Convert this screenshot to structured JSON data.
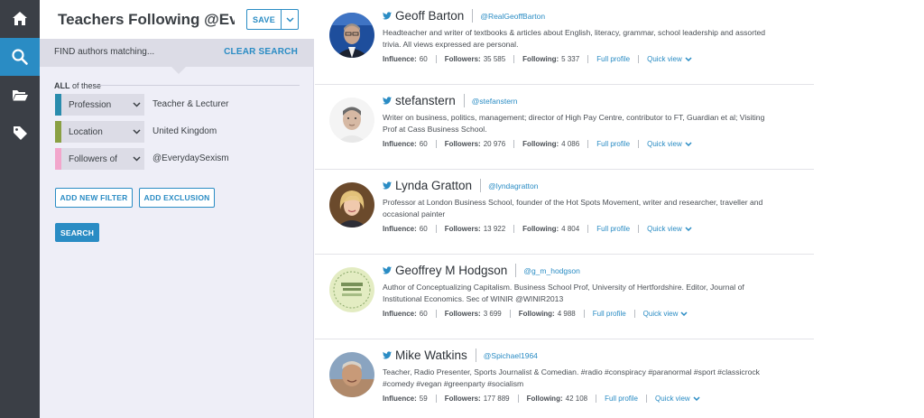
{
  "rail": {
    "items": [
      {
        "icon": "home-icon",
        "active": false
      },
      {
        "icon": "search-icon",
        "active": true
      },
      {
        "icon": "folder-open-icon",
        "active": false
      },
      {
        "icon": "tag-icon",
        "active": false
      }
    ]
  },
  "panel": {
    "title": "Teachers Following @Eve...",
    "save_label": "SAVE",
    "find_label": "FIND authors matching...",
    "clear_search": "CLEAR SEARCH",
    "all_strong": "ALL",
    "all_rest": " of these",
    "filters": [
      {
        "name": "Profession",
        "value": "Teacher & Lecturer",
        "color": "#2a8cad"
      },
      {
        "name": "Location",
        "value": "United Kingdom",
        "color": "#8aa044"
      },
      {
        "name": "Followers of",
        "value": "@EverydaySexism",
        "color": "#f2a6cc"
      }
    ],
    "add_filter": "ADD NEW FILTER",
    "add_exclusion": "ADD EXCLUSION",
    "search": "SEARCH"
  },
  "results": {
    "labels": {
      "influence": "Influence:",
      "followers": "Followers:",
      "following": "Following:",
      "full_profile": "Full profile",
      "quick_view": "Quick view"
    },
    "authors": [
      {
        "name": "Geoff Barton",
        "handle": "@RealGeoffBarton",
        "bio": "Headteacher and writer of textbooks & articles about English, literacy, grammar, school leadership and assorted trivia. All views expressed are personal.",
        "influence": "60",
        "followers": "35 585",
        "following": "5 337",
        "avatar_bg": "#1e4e9c",
        "avatar_fg": "#c9a58d"
      },
      {
        "name": "stefanstern",
        "handle": "@stefanstern",
        "bio": "Writer on business, politics, management; director of High Pay Centre, contributor to FT, Guardian et al; Visiting Prof at Cass Business School.",
        "influence": "60",
        "followers": "20 976",
        "following": "4 086",
        "avatar_bg": "#f4f4f4",
        "avatar_fg": "#d6b9a4"
      },
      {
        "name": "Lynda Gratton",
        "handle": "@lyndagratton",
        "bio": "Professor at London Business School, founder of the Hot Spots Movement, writer and researcher, traveller and occasional painter",
        "influence": "60",
        "followers": "13 922",
        "following": "4 804",
        "avatar_bg": "#6b4a2c",
        "avatar_fg": "#f0c9ad"
      },
      {
        "name": "Geoffrey M Hodgson",
        "handle": "@g_m_hodgson",
        "bio": "Author of Conceptualizing Capitalism. Business School Prof, University of Hertfordshire. Editor, Journal of Institutional Economics. Sec of WINIR @WINIR2013",
        "influence": "60",
        "followers": "3 699",
        "following": "4 988",
        "avatar_bg": "#e3ecc2",
        "avatar_fg": "#3e6b2a",
        "avatar_text": "CONCEPTUALIZING CAPITALISM"
      },
      {
        "name": "Mike Watkins",
        "handle": "@Spichael1964",
        "bio": "Teacher, Radio Presenter, Sports Journalist & Comedian. #radio #conspiracy #paranormal #sport #classicrock #comedy #vegan #greenparty #socialism",
        "influence": "59",
        "followers": "177 889",
        "following": "42 108",
        "avatar_bg": "#8aa4c0",
        "avatar_fg": "#c89a78"
      }
    ]
  },
  "colors": {
    "accent": "#2a8cc4",
    "rail": "#3b3f46",
    "panel": "#eeeef7"
  }
}
